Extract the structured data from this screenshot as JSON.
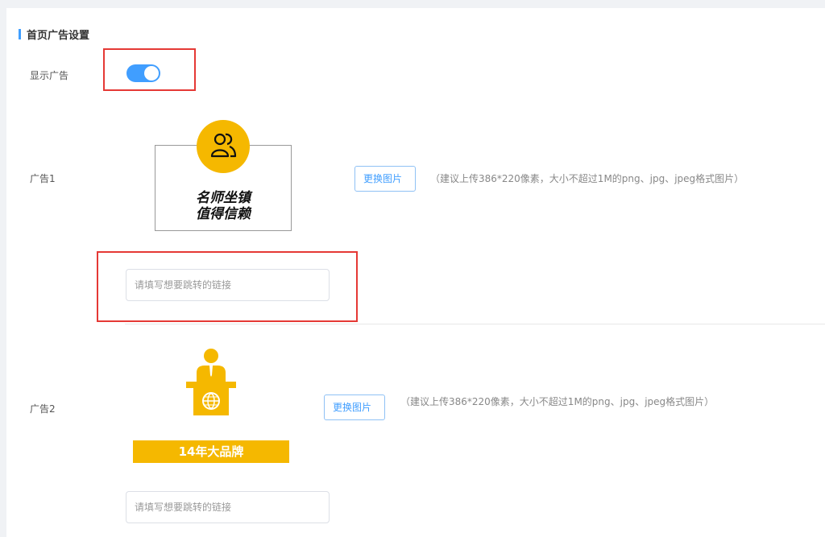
{
  "section": {
    "title": "首页广告设置"
  },
  "show_ads": {
    "label": "显示广告",
    "enabled": true
  },
  "ads": [
    {
      "label": "广告1",
      "image_text_line1": "名师坐镇",
      "image_text_line2": "值得信赖",
      "change_button": "更换图片",
      "hint": "（建议上传386*220像素，大小不超过1M的png、jpg、jpeg格式图片）",
      "link_placeholder": "请填写想要跳转的链接"
    },
    {
      "label": "广告2",
      "banner_text": "14年大品牌",
      "change_button": "更换图片",
      "hint": "（建议上传386*220像素，大小不超过1M的png、jpg、jpeg格式图片）",
      "link_placeholder": "请填写想要跳转的链接"
    }
  ],
  "colors": {
    "accent": "#409eff",
    "highlight": "#e53935",
    "ad_yellow": "#f5b800"
  }
}
